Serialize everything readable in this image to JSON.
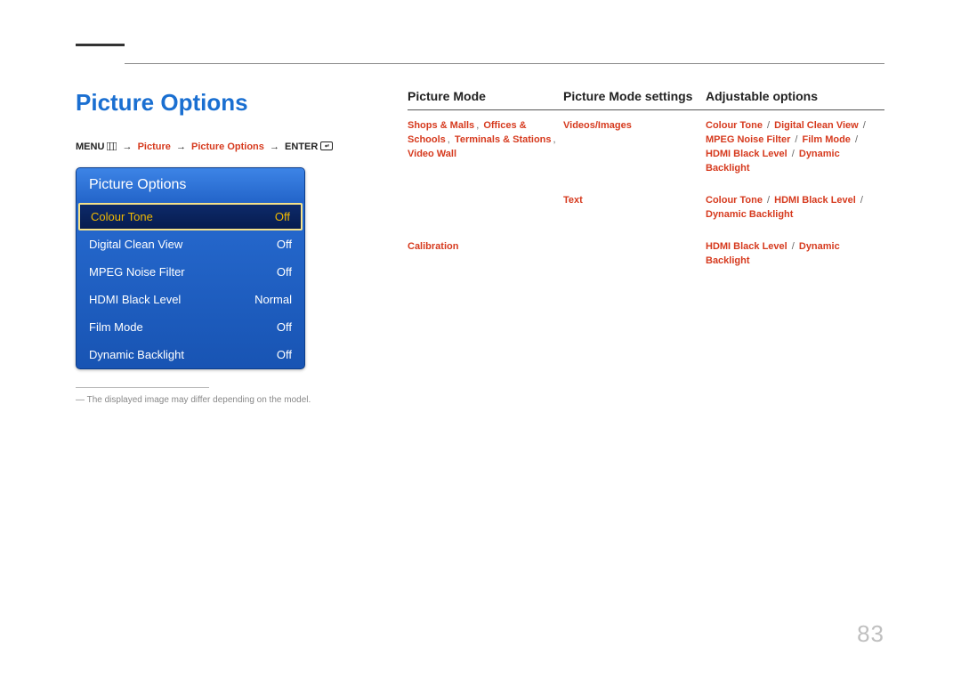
{
  "section_title": "Picture Options",
  "breadcrumb": {
    "menu_label": "MENU",
    "path1": "Picture",
    "path2": "Picture Options",
    "enter_label": "ENTER"
  },
  "menu_panel": {
    "header": "Picture Options",
    "rows": [
      {
        "label": "Colour Tone",
        "value": "Off",
        "selected": true
      },
      {
        "label": "Digital Clean View",
        "value": "Off",
        "selected": false
      },
      {
        "label": "MPEG Noise Filter",
        "value": "Off",
        "selected": false
      },
      {
        "label": "HDMI Black Level",
        "value": "Normal",
        "selected": false
      },
      {
        "label": "Film Mode",
        "value": "Off",
        "selected": false
      },
      {
        "label": "Dynamic Backlight",
        "value": "Off",
        "selected": false
      }
    ]
  },
  "footnote": "The displayed image may differ depending on the model.",
  "table": {
    "headers": {
      "mode": "Picture Mode",
      "settings": "Picture Mode settings",
      "options": "Adjustable options"
    },
    "rows": [
      {
        "mode_parts": [
          "Shops & Malls",
          ", ",
          "Offices & Schools",
          ", ",
          "Terminals & Stations",
          ", ",
          "Video Wall"
        ],
        "settings": "Videos/Images",
        "options_parts": [
          "Colour Tone",
          " / ",
          "Digital Clean View",
          " / ",
          "MPEG Noise Filter",
          " / ",
          "Film Mode",
          " / ",
          "HDMI Black Level",
          " / ",
          "Dynamic Backlight"
        ]
      },
      {
        "mode_parts": [],
        "settings": "Text",
        "options_parts": [
          "Colour Tone",
          " / ",
          "HDMI Black Level",
          " / ",
          "Dynamic Backlight"
        ]
      },
      {
        "mode_parts": [
          "Calibration"
        ],
        "settings": "",
        "options_parts": [
          "HDMI Black Level",
          " / ",
          "Dynamic Backlight"
        ]
      }
    ]
  },
  "page_number": "83"
}
